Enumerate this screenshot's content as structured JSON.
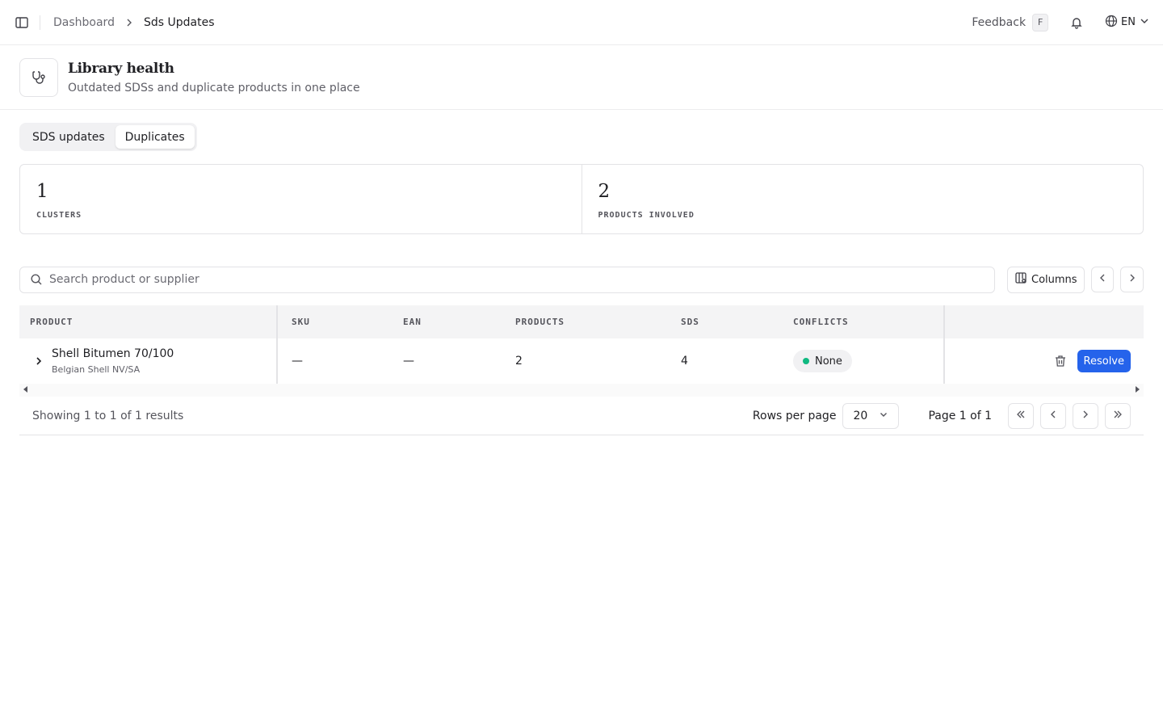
{
  "topbar": {
    "breadcrumb": [
      "Dashboard",
      "Sds Updates"
    ],
    "feedback_label": "Feedback",
    "feedback_shortcut": "F",
    "language": "EN"
  },
  "header": {
    "title": "Library health",
    "subtitle": "Outdated SDSs and duplicate products in one place",
    "icon": "stethoscope-icon"
  },
  "tabs": [
    {
      "label": "SDS updates",
      "active": false
    },
    {
      "label": "Duplicates",
      "active": true
    }
  ],
  "stats": [
    {
      "value": "1",
      "label": "CLUSTERS"
    },
    {
      "value": "2",
      "label": "PRODUCTS INVOLVED"
    }
  ],
  "search": {
    "placeholder": "Search product or supplier"
  },
  "toolbar": {
    "columns_label": "Columns"
  },
  "table": {
    "columns": [
      "PRODUCT",
      "SKU",
      "EAN",
      "PRODUCTS",
      "SDS",
      "CONFLICTS"
    ],
    "rows": [
      {
        "product": "Shell Bitumen 70/100",
        "supplier": "Belgian Shell NV/SA",
        "sku": "—",
        "ean": "—",
        "products": "2",
        "sds": "4",
        "conflicts": "None",
        "conflicts_color": "#10b981",
        "action_label": "Resolve"
      }
    ]
  },
  "footer": {
    "showing": "Showing 1 to 1 of 1 results",
    "rows_per_page_label": "Rows per page",
    "rows_per_page": "20",
    "page_info": "Page 1 of 1"
  },
  "colors": {
    "accent": "#2563eb",
    "success": "#10b981"
  }
}
